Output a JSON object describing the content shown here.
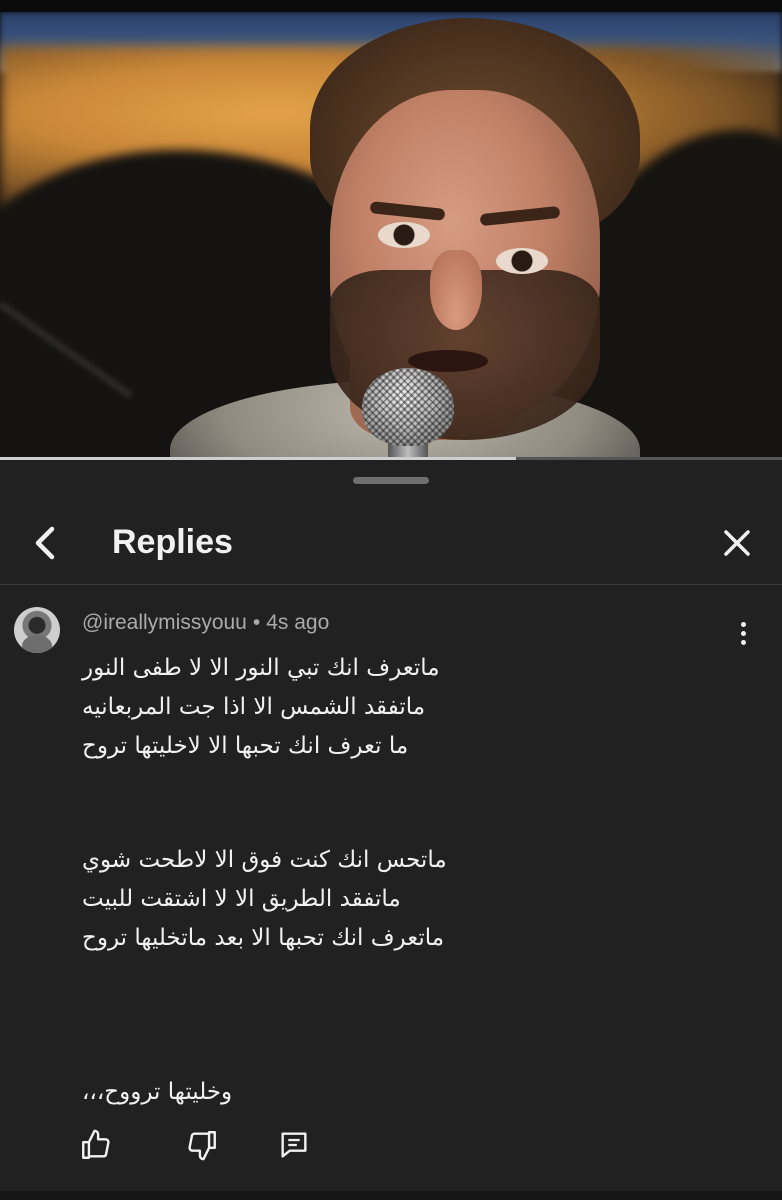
{
  "video": {
    "progress_fraction": 0.66
  },
  "sheet": {
    "title": "Replies"
  },
  "comment": {
    "author": "@ireallymissyouu",
    "separator": "•",
    "time": "4s ago",
    "stanza1": [
      "ماتعرف انك تبي النور الا لا طفى النور",
      "ماتفقد الشمس الا اذا جت المربعانيه",
      "ما تعرف انك تحبها الا لاخليتها تروح"
    ],
    "stanza2": [
      "ماتحس انك كنت فوق الا لاطحت شوي",
      "ماتفقد الطريق الا لا اشتقت للبيت",
      "ماتعرف انك تحبها الا بعد ماتخليها تروح"
    ],
    "stanza3": [
      "وخليتها ترووح،،،"
    ]
  },
  "icons": {
    "back": "chevron-left-icon",
    "close": "close-icon",
    "more": "more-vertical-icon",
    "like": "thumbs-up-icon",
    "dislike": "thumbs-down-icon",
    "reply": "comment-icon"
  },
  "colors": {
    "sheet_background": "#212121",
    "text_primary": "#f1f1f1",
    "text_secondary": "#aaaaaa"
  }
}
